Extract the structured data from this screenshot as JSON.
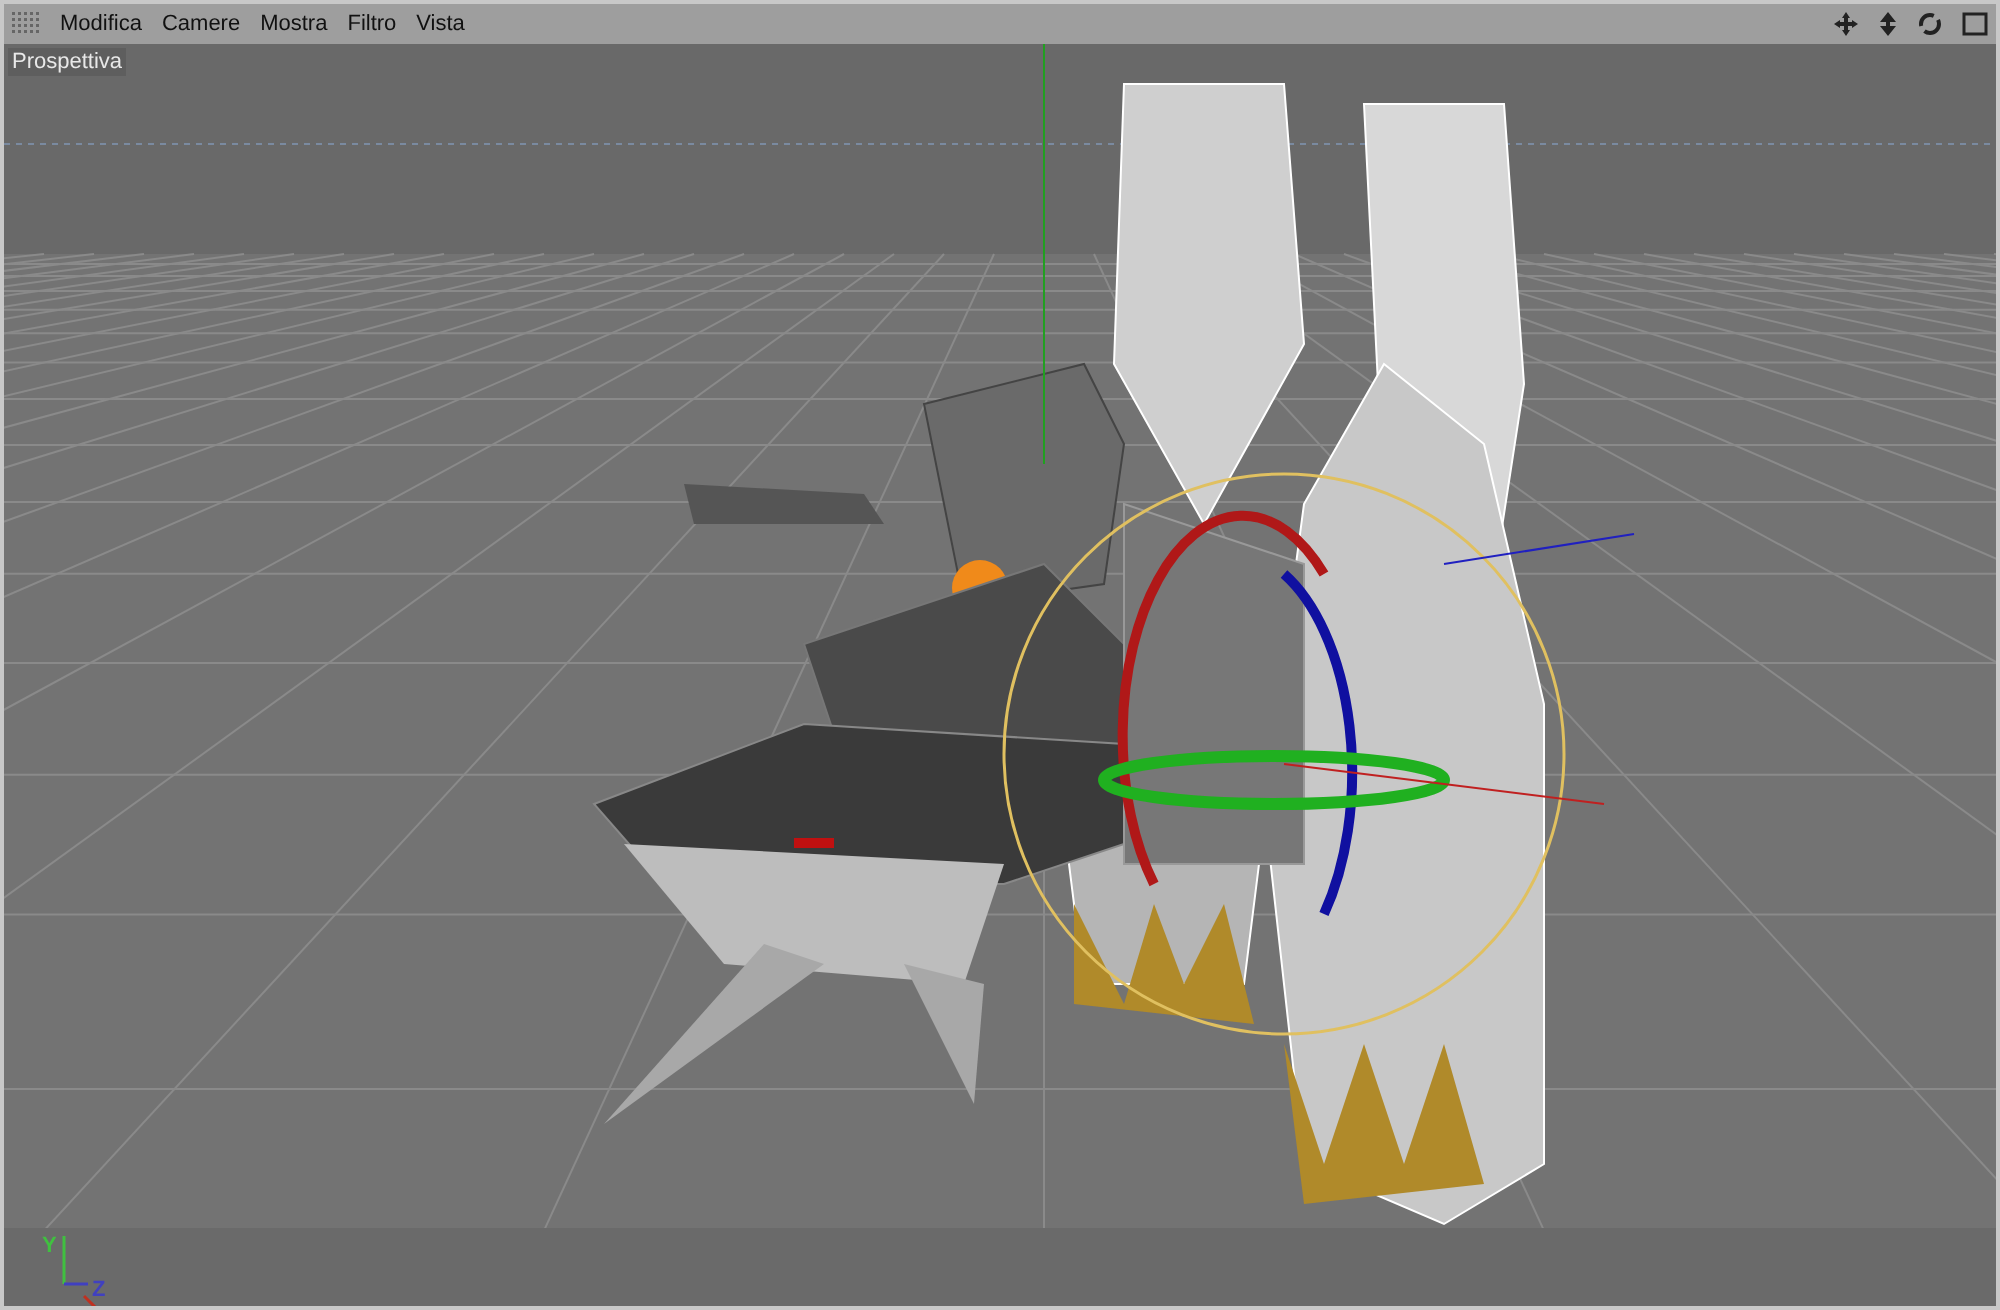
{
  "menu": [
    {
      "label": "Modifica"
    },
    {
      "label": "Camere"
    },
    {
      "label": "Mostra"
    },
    {
      "label": "Filtro"
    },
    {
      "label": "Vista"
    }
  ],
  "viewport": {
    "label": "Prospettiva",
    "axis_labels": [
      {
        "kind": "y",
        "text": "Y"
      },
      {
        "kind": "z",
        "text": "Z"
      }
    ]
  }
}
